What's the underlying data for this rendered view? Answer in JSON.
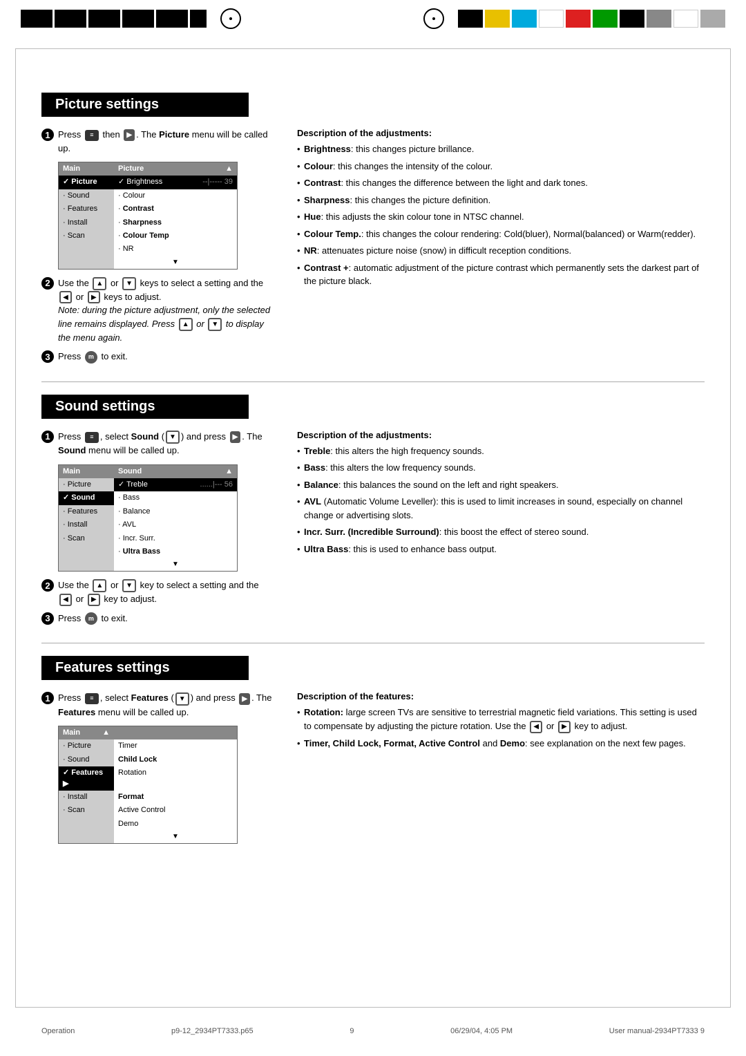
{
  "header": {
    "black_blocks": [
      50,
      50,
      50,
      50,
      50,
      20
    ],
    "color_blocks": [
      "#000",
      "#f0c020",
      "#00aaee",
      "#fff",
      "#ee2020",
      "#008800",
      "#000",
      "#aaa",
      "#fff",
      "#aaa"
    ],
    "crosshair_left": true,
    "crosshair_right": true
  },
  "picture_settings": {
    "title": "Picture settings",
    "step1_text": "Press",
    "step1_then": "then",
    "step1_desc": ". The",
    "step1_menu": "Picture",
    "step1_suffix": "menu will be called up.",
    "step2_text": "Use the",
    "step2_keys": "or",
    "step2_select": "keys to select a setting and the",
    "step2_adj": "or",
    "step2_adjust": "keys to adjust.",
    "step2_note": "Note: during the picture adjustment, only the selected line remains displayed. Press",
    "step2_note2": "or",
    "step2_note3": "to display the menu again.",
    "step3_text": "Press",
    "step3_suffix": "to exit.",
    "menu": {
      "left_header": "Main",
      "right_header": "Picture",
      "left_items": [
        "✓ Picture",
        "· Sound",
        "· Features",
        "· Install",
        "· Scan"
      ],
      "right_items_selected": "✓ Brightness",
      "right_items": [
        "· Colour",
        "· Contrast",
        "· Sharpness",
        "· Colour Temp",
        "· NR"
      ],
      "right_value": "--|----- 39",
      "arrow_down": "▼"
    },
    "description_title": "Description of the adjustments:",
    "desc_items": [
      {
        "bold": "Brightness",
        "text": ": this changes picture brillance."
      },
      {
        "bold": "Colour",
        "text": ": this changes the intensity of the colour."
      },
      {
        "bold": "Contrast",
        "text": ": this changes the difference between the light and dark tones."
      },
      {
        "bold": "Sharpness",
        "text": ": this changes the picture definition."
      },
      {
        "bold": "Hue",
        "text": ": this adjusts the skin colour tone in NTSC channel."
      },
      {
        "bold": "Colour Temp.",
        "text": ": this changes the colour rendering: Cold(bluer), Normal(balanced) or Warm(redder)."
      },
      {
        "bold": "NR",
        "text": ": attenuates picture noise (snow) in difficult reception conditions."
      },
      {
        "bold": "Contrast +",
        "text": ": automatic adjustment of the picture contrast which permanently sets the darkest part of the picture black."
      }
    ]
  },
  "sound_settings": {
    "title": "Sound settings",
    "step1_text": "Press",
    "step1_select": "select Sound (",
    "step1_and": ") and press",
    "step1_desc": ". The",
    "step1_menu": "Sound",
    "step1_suffix": "menu will be called up.",
    "step2_text": "Use the",
    "step2_or": "or",
    "step2_key": "key to select a setting and the",
    "step2_or2": "or",
    "step2_adjust": "key to adjust.",
    "step3_text": "Press",
    "step3_suffix": "to exit.",
    "menu": {
      "left_header": "Main",
      "right_header": "Sound",
      "left_items": [
        "· Picture",
        "✓ Sound",
        "· Features",
        "· Install",
        "· Scan"
      ],
      "right_items_selected": "✓ Treble",
      "right_items": [
        "· Bass",
        "· Balance",
        "· AVL",
        "· Incr. Surr.",
        "· Ultra Bass"
      ],
      "right_value": "......|--- 56",
      "arrow_down": "▼"
    },
    "description_title": "Description of the adjustments:",
    "desc_items": [
      {
        "bold": "Treble",
        "text": ": this alters the high frequency sounds."
      },
      {
        "bold": "Bass",
        "text": ": this alters the low frequency sounds."
      },
      {
        "bold": "Balance",
        "text": ": this balances the sound on the left and right speakers."
      },
      {
        "bold": "AVL",
        "text": " (Automatic Volume Leveller): this is used to limit increases in sound, especially on channel change or advertising slots."
      },
      {
        "bold": "Incr. Surr. (Incredible Surround)",
        "text": ": this boost the effect of stereo sound."
      },
      {
        "bold": "Ultra Bass",
        "text": ": this is used to enhance bass output."
      }
    ]
  },
  "features_settings": {
    "title": "Features settings",
    "step1_text": "Press",
    "step1_select": "select",
    "step1_menu_name": "Features",
    "step1_and": "and press",
    "step1_desc": ". The",
    "step1_menu": "Features",
    "step1_suffix": "menu will be called up.",
    "menu": {
      "left_header": "Main",
      "right_header": "",
      "left_items": [
        "· Picture",
        "· Sound",
        "✓ Features",
        "· Install",
        "· Scan"
      ],
      "right_items": [
        "Timer",
        "Child Lock",
        "Rotation",
        "Format",
        "Active Control",
        "Demo"
      ],
      "selected_left": "✓ Features",
      "arrow": "▶",
      "arrow_down": "▼"
    },
    "description_title": "Description of the features:",
    "desc_items": [
      {
        "bold": "Rotation:",
        "text": " large screen TVs are sensitive to terrestrial magnetic field variations. This setting is used to compensate by adjusting the picture rotation. Use the",
        "bold2": "",
        "text2": " or",
        "text3": " key to adjust."
      },
      {
        "bold": "Timer, Child Lock, Format, Active Control",
        "text": " and",
        "bold2": "Demo",
        "text2": ": see explanation on the next few pages."
      }
    ]
  },
  "footer": {
    "left": "Operation",
    "center_file": "p9-12_2934PT7333.p65",
    "center_page": "9",
    "right": "User manual-2934PT7333     9",
    "date": "06/29/04, 4:05 PM"
  }
}
